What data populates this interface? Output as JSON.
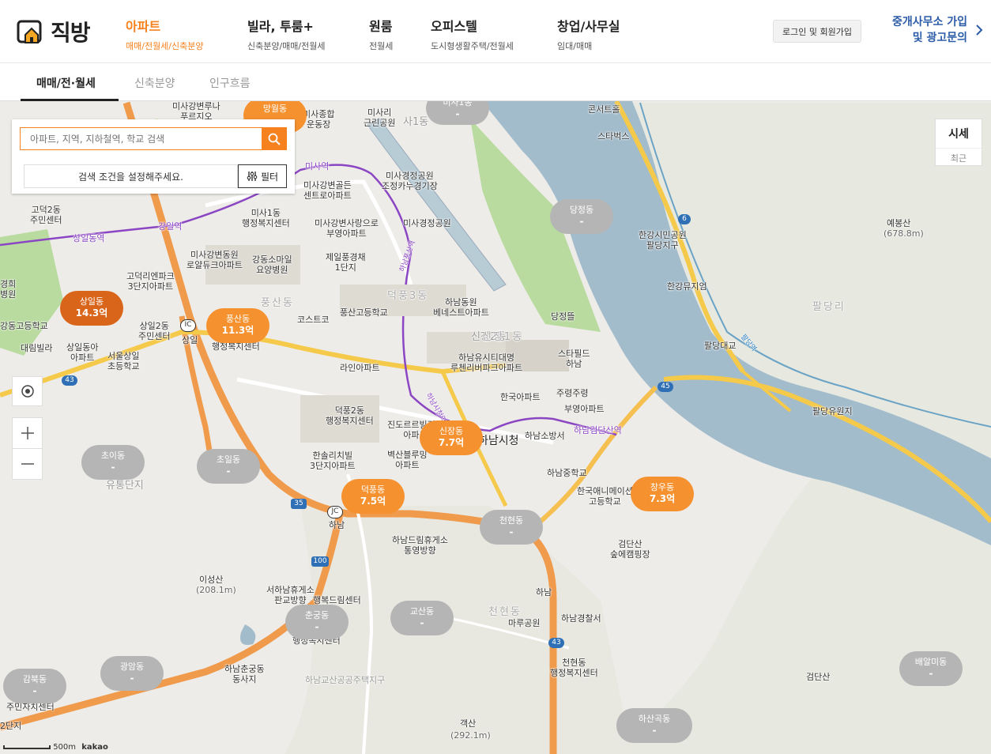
{
  "header": {
    "logo_text": "직방",
    "nav": [
      {
        "title": "아파트",
        "sub": "매매/전월세/신축분양"
      },
      {
        "title": "빌라, 투룸+",
        "sub": "신축분양/매매/전월세"
      },
      {
        "title": "원룸",
        "sub": "전월세"
      },
      {
        "title": "오피스텔",
        "sub": "도시형생활주택/전월세"
      },
      {
        "title": "창업/사무실",
        "sub": "임대/매매"
      }
    ],
    "login_label": "로그인 및 회원가입",
    "biz_line1": "중개사무소 가입",
    "biz_line2": "및 광고문의"
  },
  "subtabs": [
    "매매/전·월세",
    "신축분양",
    "인구흐름"
  ],
  "search": {
    "placeholder": "아파트, 지역, 지하철역, 학교 검색",
    "condition_text": "검색 조건을 설정해주세요.",
    "filter_label": "필터"
  },
  "price_toggle": {
    "title": "시세",
    "sub": "최근"
  },
  "bubbles": [
    {
      "name": "망월동",
      "value": "-"
    },
    {
      "name": "미사1동",
      "value": "-"
    },
    {
      "name": "상일동",
      "value": "14.3억"
    },
    {
      "name": "풍산동",
      "value": "11.3억"
    },
    {
      "name": "당정동",
      "value": "-"
    },
    {
      "name": "신장동",
      "value": "7.7억"
    },
    {
      "name": "덕풍동",
      "value": "7.5억"
    },
    {
      "name": "창우동",
      "value": "7.3억"
    },
    {
      "name": "초이동",
      "value": "-"
    },
    {
      "name": "초일동",
      "value": "-"
    },
    {
      "name": "천현동",
      "value": "-"
    },
    {
      "name": "춘궁동",
      "value": "-"
    },
    {
      "name": "교산동",
      "value": "-"
    },
    {
      "name": "광암동",
      "value": "-"
    },
    {
      "name": "감북동",
      "value": "-"
    },
    {
      "name": "배알미동",
      "value": "-"
    },
    {
      "name": "하산곡동",
      "value": "-"
    }
  ],
  "places": {
    "p1": "미사강변루나\n푸르지오",
    "p2": "미사종합\n운동장",
    "p3": "미사리\n근린공원",
    "p4": "사1동",
    "p5": "콘서트홀",
    "p6": "스타벅스",
    "p7": "미사역",
    "p8": "미사강변골든\n센트로아파트",
    "p9": "미사경정공원\n조정카누경기장",
    "p10": "미사경정공원",
    "p11": "고덕2동\n주민센터",
    "p12": "미사1동\n행정복지센터",
    "p13": "미사강변사랑으로\n부영아파트",
    "p14": "강일역",
    "p15": "상일동역",
    "p16": "미사강변동원\n로얄듀크아파트",
    "p17": "강동소마일\n요양병원",
    "p18": "제일풍경채\n1단지",
    "p19": "고덕리엔파크\n3단지아파트",
    "p20": "경희\n병원",
    "p21": "상일2동\n주민센터",
    "p22": "코스트코",
    "p23": "풍산고등학교",
    "p24": "하남동원\n베네스트아파트",
    "p25": "강동고등학교",
    "p26": "상일동아\n아파트",
    "p27": "대림빌라",
    "p28": "서울상일\n초등학교",
    "p29": "상일",
    "p30": "행정복지센터",
    "p31": "신장2동",
    "p32": "당정뜰",
    "p33": "하남유시티대명\n루첸리버파크아파트",
    "p34": "스타필드\n하남",
    "p35": "라인아파트",
    "p36": "한국아파트",
    "p37": "주령주령",
    "p38": "부영아파트",
    "p39": "덕풍2동\n행정복지센터",
    "p40": "진도르르빌리지\n아파트",
    "p41": "하남시청",
    "p42": "하남소방서",
    "p43": "하남검단산역",
    "p44": "한솔리치빌\n3단지아파트",
    "p45": "벽산블루밍\n아파트",
    "p46": "하남중학교",
    "p47": "한국애니메이션\n고등학교",
    "p48": "하남",
    "p49": "하남드림휴게소\n통영방향",
    "p50": "검단산\n숲에캠핑장",
    "p51": "이성산",
    "p52": "(208.1m)",
    "p53": "서하남휴게소\n판교방향",
    "p54": "행복드림센터",
    "p55": "행정복지센터",
    "p56": "하남춘궁동\n동사지",
    "p57": "하남",
    "p58": "하남경찰서",
    "p59": "마루공원",
    "p60": "천현동\n행정복지센터",
    "p61": "주민자치센터",
    "p62": "2단지",
    "p63": "객산",
    "p64": "(292.1m)",
    "p65": "검단산",
    "p66": "예봉산",
    "p67": "(678.8m)",
    "p68": "한강시민공원\n팔당지구",
    "p69": "한강뮤지엄",
    "p70": "팔당대교",
    "p71": "팔당유원지",
    "p72": "팔당리",
    "p73": "풍산동",
    "p74": "신장1동",
    "p75": "덕풍3동",
    "p76": "천현동",
    "p77": "유통단지",
    "p78": "하남교산공공주택지구",
    "p79": "하남검단산역",
    "p80": "팔당역",
    "p81": "하남풍산역",
    "p82": "하남시청역"
  },
  "road_numbers": [
    "6",
    "45",
    "43",
    "35",
    "100",
    "43",
    "IC",
    "JC"
  ],
  "scale": {
    "label": "500m",
    "brand": "kakao"
  },
  "colors": {
    "accent": "#f5821f",
    "link": "#2c5ca8",
    "river": "#a2bccc",
    "park": "#b9dba0"
  }
}
